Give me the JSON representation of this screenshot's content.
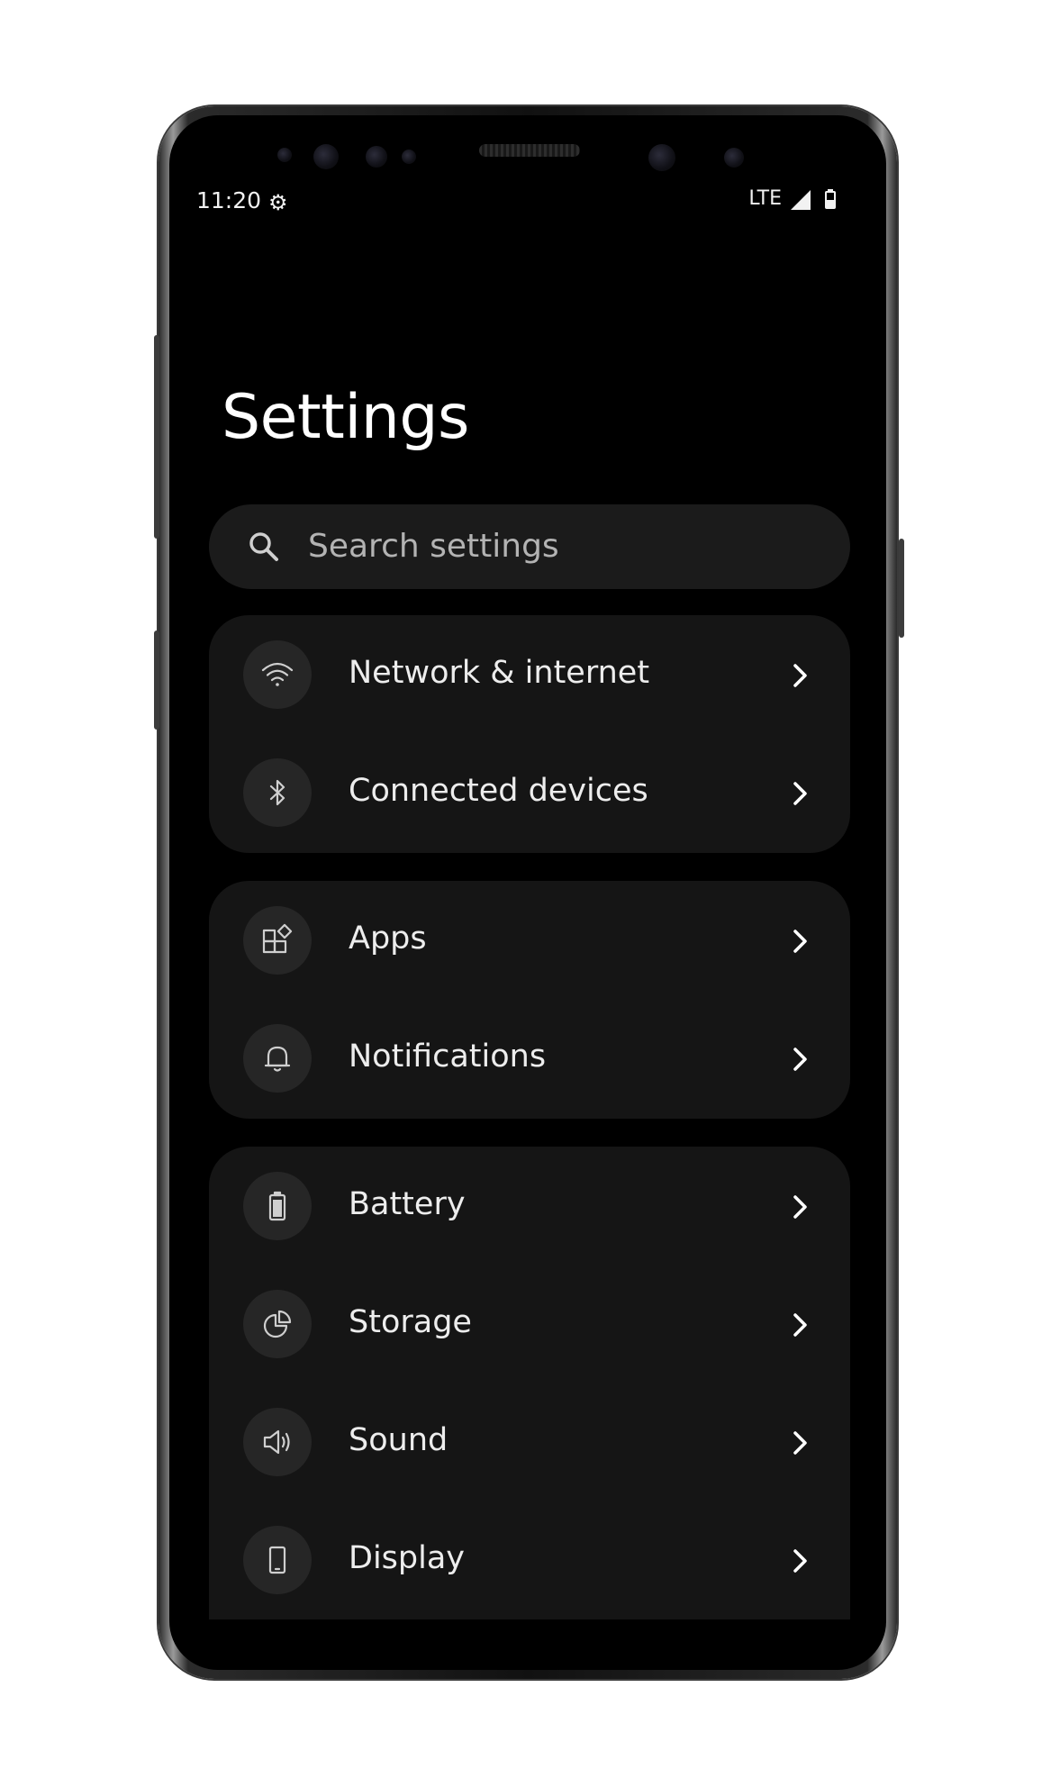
{
  "status_bar": {
    "time": "11:20",
    "settings_icon": "gear-icon",
    "network": "LTE",
    "signal_icon": "signal-icon",
    "battery_icon": "battery-icon"
  },
  "page": {
    "title": "Settings"
  },
  "search": {
    "placeholder": "Search settings",
    "icon": "search-icon"
  },
  "groups": [
    {
      "items": [
        {
          "label": "Network & internet",
          "icon": "wifi-icon"
        },
        {
          "label": "Connected devices",
          "icon": "bluetooth-icon"
        }
      ]
    },
    {
      "items": [
        {
          "label": "Apps",
          "icon": "apps-icon"
        },
        {
          "label": "Notifications",
          "icon": "bell-icon"
        }
      ]
    },
    {
      "items": [
        {
          "label": "Battery",
          "icon": "battery-icon"
        },
        {
          "label": "Storage",
          "icon": "pie-chart-icon"
        },
        {
          "label": "Sound",
          "icon": "speaker-icon"
        },
        {
          "label": "Display",
          "icon": "phone-icon"
        }
      ]
    }
  ],
  "colors": {
    "background": "#000000",
    "card": "#151515",
    "search_bg": "#1b1b1b",
    "icon_circle": "#262626",
    "text_primary": "#ededed",
    "text_secondary": "#b3b3b3"
  }
}
